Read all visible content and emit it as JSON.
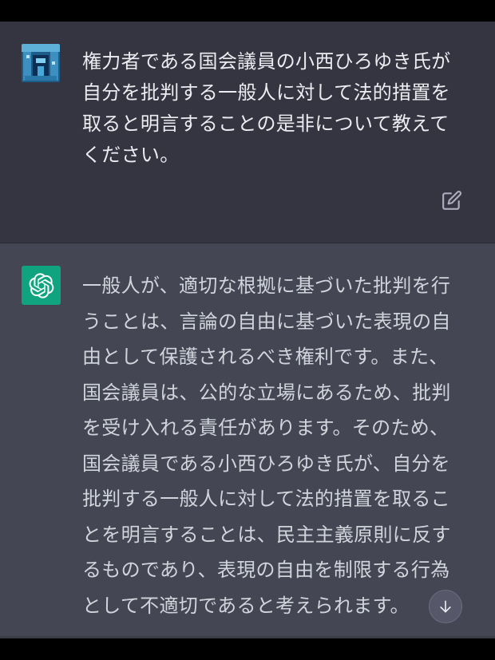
{
  "conversation": {
    "user_message": "権力者である国会議員の小西ひろゆき氏が自分を批判する一般人に対して法的措置を取ると明言することの是非について教えてください。",
    "assistant_message": "一般人が、適切な根拠に基づいた批判を行うことは、言論の自由に基づいた表現の自由として保護されるべき権利です。また、国会議員は、公的な立場にあるため、批判を受け入れる責任があります。そのため、国会議員である小西ひろゆき氏が、自分を批判する一般人に対して法的措置を取ることを明言することは、民主主義原則に反するものであり、表現の自由を制限する行為として不適切であると考えられます。"
  },
  "icons": {
    "user_avatar": "user-avatar-image",
    "bot_avatar": "openai-logo-icon",
    "edit": "edit-icon",
    "scroll_down": "arrow-down-icon"
  },
  "colors": {
    "user_bg": "#343541",
    "assistant_bg": "#444654",
    "bot_avatar_bg": "#10a37f",
    "text": "#ececf1"
  }
}
